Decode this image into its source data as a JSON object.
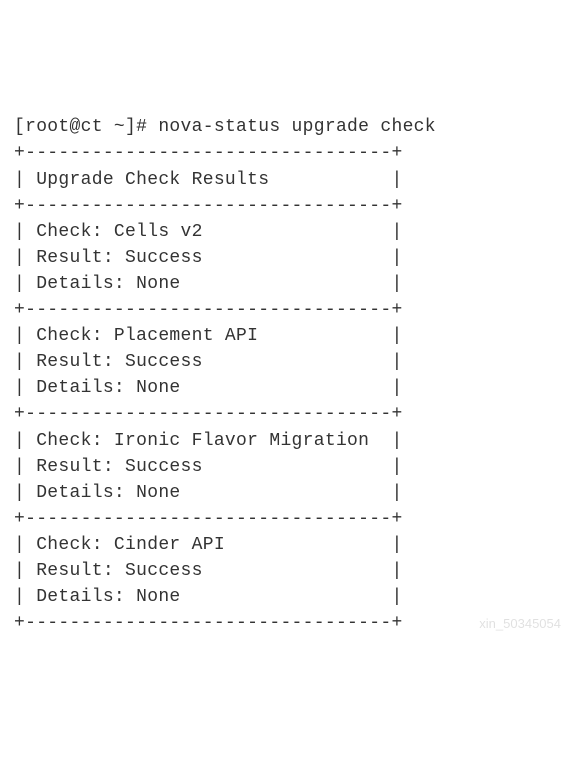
{
  "terminal": {
    "prompt": "[root@ct ~]# ",
    "command": "nova-status upgrade check",
    "border": "+---------------------------------+",
    "header_row": "| Upgrade Check Results           |",
    "checks": [
      {
        "check": "| Check: Cells v2                 |",
        "result": "| Result: Success                 |",
        "details": "| Details: None                   |"
      },
      {
        "check": "| Check: Placement API            |",
        "result": "| Result: Success                 |",
        "details": "| Details: None                   |"
      },
      {
        "check": "| Check: Ironic Flavor Migration  |",
        "result": "| Result: Success                 |",
        "details": "| Details: None                   |"
      },
      {
        "check": "| Check: Cinder API               |",
        "result": "| Result: Success                 |",
        "details": "| Details: None                   |"
      }
    ]
  },
  "table": {
    "title": "Upgrade Check Results",
    "rows": [
      {
        "check": "Cells v2",
        "result": "Success",
        "details": "None"
      },
      {
        "check": "Placement API",
        "result": "Success",
        "details": "None"
      },
      {
        "check": "Ironic Flavor Migration",
        "result": "Success",
        "details": "None"
      },
      {
        "check": "Cinder API",
        "result": "Success",
        "details": "None"
      }
    ]
  },
  "watermark": "xin_50345054"
}
